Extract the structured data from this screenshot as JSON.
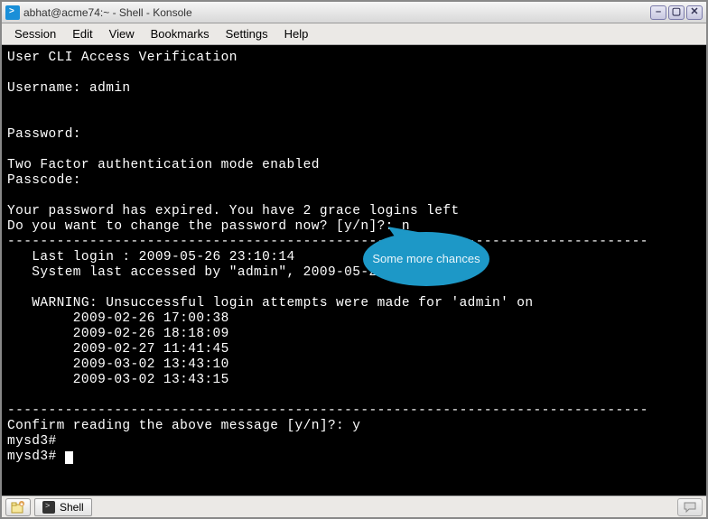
{
  "window": {
    "title": "abhat@acme74:~ - Shell - Konsole"
  },
  "menubar": {
    "items": [
      "Session",
      "Edit",
      "View",
      "Bookmarks",
      "Settings",
      "Help"
    ]
  },
  "terminal": {
    "header": "User CLI Access Verification",
    "username_label": "Username: ",
    "username_value": "admin",
    "password_label": "Password:",
    "twofactor_line": "Two Factor authentication mode enabled",
    "passcode_label": "Passcode:",
    "expired_line": "Your password has expired. You have 2 grace logins left",
    "change_prompt": "Do you want to change the password now? [y/n]?: ",
    "change_answer": "n",
    "hr": "------------------------------------------------------------------------------",
    "last_login": "   Last login : 2009-05-26 23:10:14",
    "system_access": "   System last accessed by \"admin\", 2009-05-26 23:10:20",
    "warning_header": "   WARNING: Unsuccessful login attempts were made for 'admin' on",
    "attempts": [
      "        2009-02-26 17:00:38",
      "        2009-02-26 18:18:09",
      "        2009-02-27 11:41:45",
      "        2009-03-02 13:43:10",
      "        2009-03-02 13:43:15"
    ],
    "confirm_prompt": "Confirm reading the above message [y/n]?: ",
    "confirm_answer": "y",
    "prompt1": "mysd3#",
    "prompt2": "mysd3# "
  },
  "statusbar": {
    "tab_label": "Shell"
  },
  "callout": {
    "text": "Some more chances"
  }
}
